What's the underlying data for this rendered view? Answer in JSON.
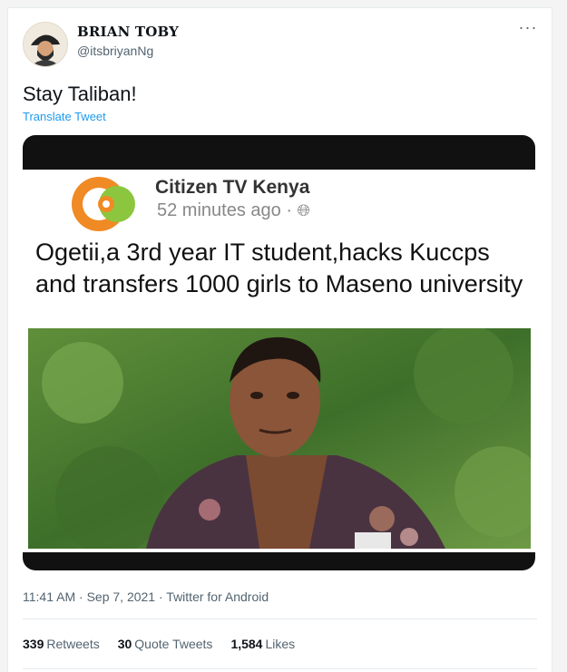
{
  "author": {
    "name": "BRIAN TOBY",
    "handle": "@itsbriyanNg"
  },
  "tweet": {
    "text": "Stay Taliban!",
    "translate_label": "Translate Tweet",
    "more_icon": "ellipsis-icon"
  },
  "media": {
    "source_name": "Citizen TV Kenya",
    "time_ago": "52 minutes ago",
    "headline": "Ogetii,a 3rd year IT student,hacks Kuccps and transfers 1000 girls to Maseno university",
    "logo_colors": {
      "orange": "#f08a24",
      "green": "#8cc63f"
    }
  },
  "meta": {
    "time": "11:41 AM",
    "date": "Sep 7, 2021",
    "client": "Twitter for Android",
    "separator": "·"
  },
  "stats": {
    "retweets_count": "339",
    "retweets_label": "Retweets",
    "quotes_count": "30",
    "quotes_label": "Quote Tweets",
    "likes_count": "1,584",
    "likes_label": "Likes"
  },
  "colors": {
    "link": "#1d9bf0",
    "secondary_text": "#536471"
  }
}
